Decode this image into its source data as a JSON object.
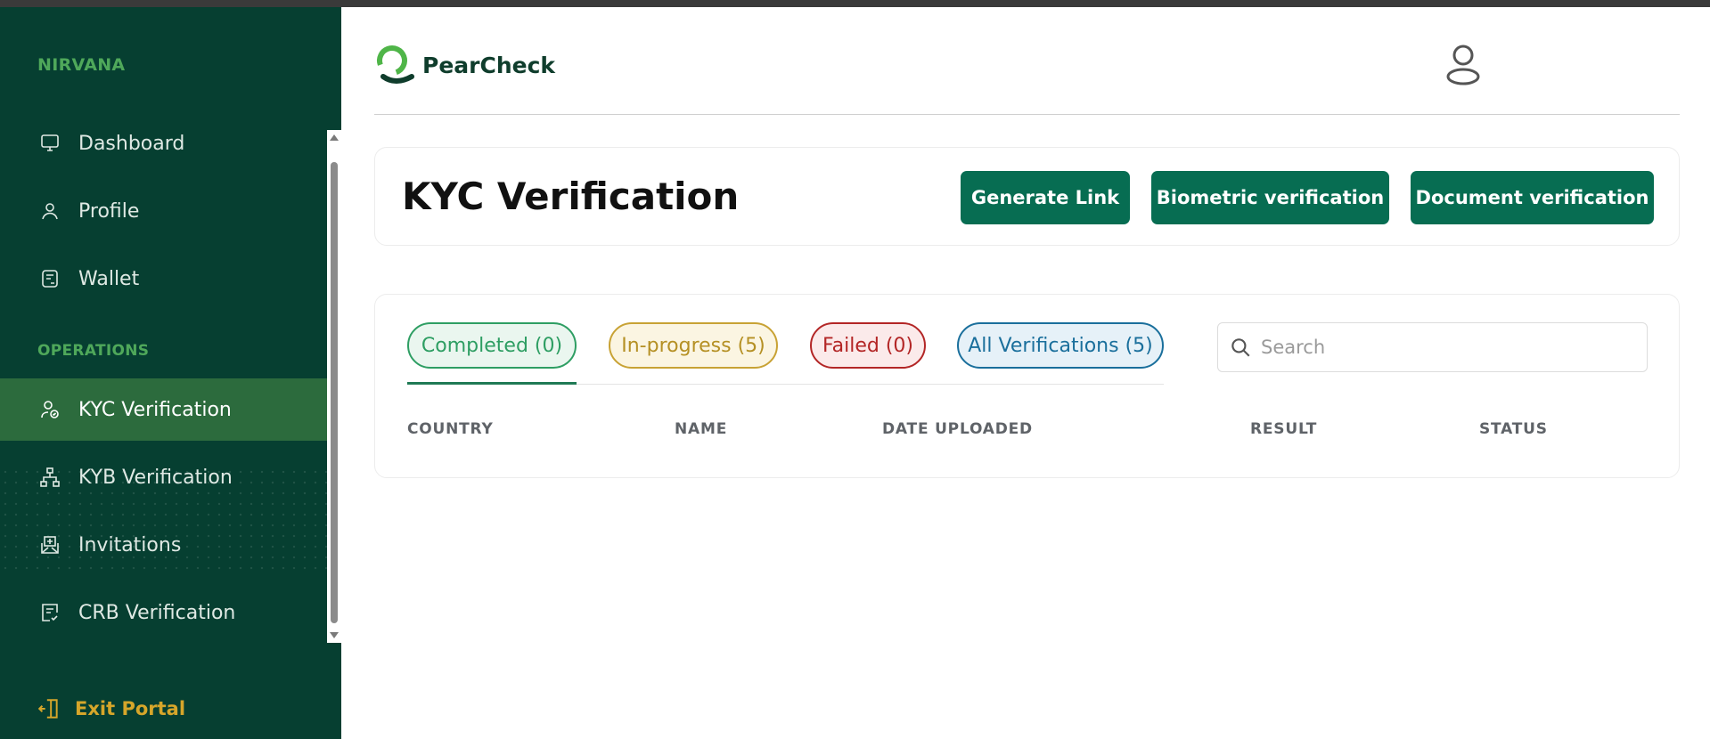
{
  "sidebar": {
    "brand": "NIRVANA",
    "items": [
      {
        "label": "Dashboard",
        "icon": "monitor-icon"
      },
      {
        "label": "Profile",
        "icon": "user-icon"
      },
      {
        "label": "Wallet",
        "icon": "wallet-icon"
      }
    ],
    "operations_label": "OPERATIONS",
    "operations": [
      {
        "label": "KYC Verification",
        "icon": "kyc-icon",
        "active": true
      },
      {
        "label": "KYB Verification",
        "icon": "org-chart-icon"
      },
      {
        "label": "Invitations",
        "icon": "envelope-icon"
      },
      {
        "label": "CRB Verification",
        "icon": "document-check-icon"
      }
    ],
    "exit_label": "Exit Portal"
  },
  "header": {
    "logo_text": "PearCheck"
  },
  "main": {
    "title": "KYC Verification",
    "buttons": {
      "generate_link": "Generate Link",
      "biometric": "Biometric verification",
      "document": "Document verification"
    },
    "tabs": [
      {
        "label": "Completed (0)"
      },
      {
        "label": "In-progress (5)"
      },
      {
        "label": "Failed (0)"
      },
      {
        "label": "All Verifications (5)"
      }
    ],
    "search": {
      "placeholder": "Search",
      "value": ""
    },
    "columns": [
      "COUNTRY",
      "NAME",
      "DATE UPLOADED",
      "RESULT",
      "STATUS"
    ]
  },
  "colors": {
    "sidebar_bg": "#063f31",
    "active_item_bg": "#2c6b3d",
    "button_bg": "#076d52",
    "exit_color": "#d6a62a",
    "completed": "#2e9e63",
    "in_progress": "#c8a234",
    "failed": "#b32626",
    "all": "#1a6f9c"
  }
}
